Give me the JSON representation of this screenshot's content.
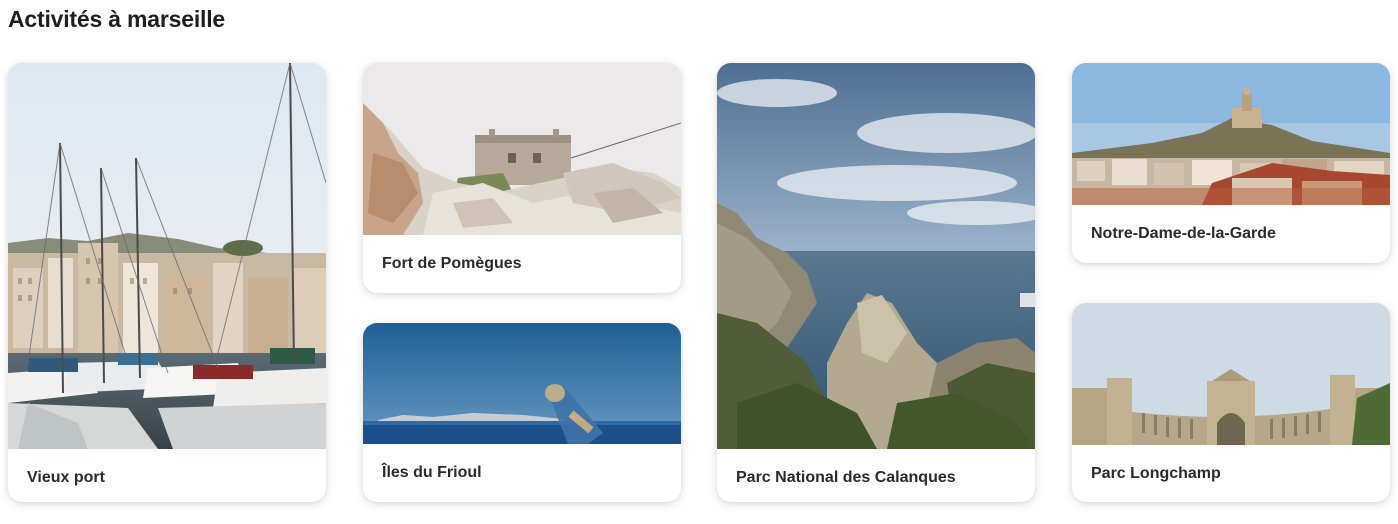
{
  "section": {
    "title": "Activités à marseille"
  },
  "activities": [
    {
      "name": "Vieux port"
    },
    {
      "name": "Fort de Pomègues"
    },
    {
      "name": "Îles du Frioul"
    },
    {
      "name": "Parc National des Calanques"
    },
    {
      "name": "Notre-Dame-de-la-Garde"
    },
    {
      "name": "Parc Longchamp"
    }
  ]
}
